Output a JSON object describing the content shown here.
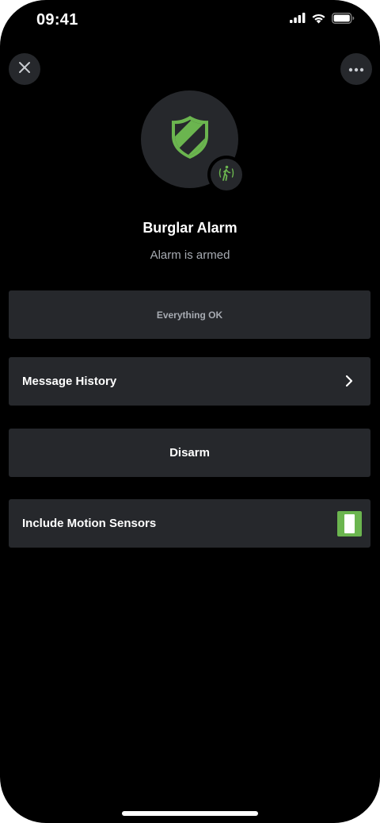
{
  "status_bar": {
    "time": "09:41",
    "icons": [
      "cellular-signal-icon",
      "wifi-icon",
      "battery-icon"
    ]
  },
  "header": {
    "close_icon": "close-icon",
    "more_icon": "more-icon"
  },
  "device": {
    "icon": "shield-icon",
    "badge_icon": "motion-sensor-icon",
    "name": "Burglar Alarm",
    "state": "Alarm is armed"
  },
  "rows": {
    "status": "Everything OK",
    "history": "Message History",
    "disarm": "Disarm",
    "motion": "Include Motion Sensors",
    "motion_enabled": true
  },
  "colors": {
    "accent": "#6bb54f",
    "card": "#26282c",
    "background": "#000000",
    "muted_text": "#a7abb2"
  }
}
